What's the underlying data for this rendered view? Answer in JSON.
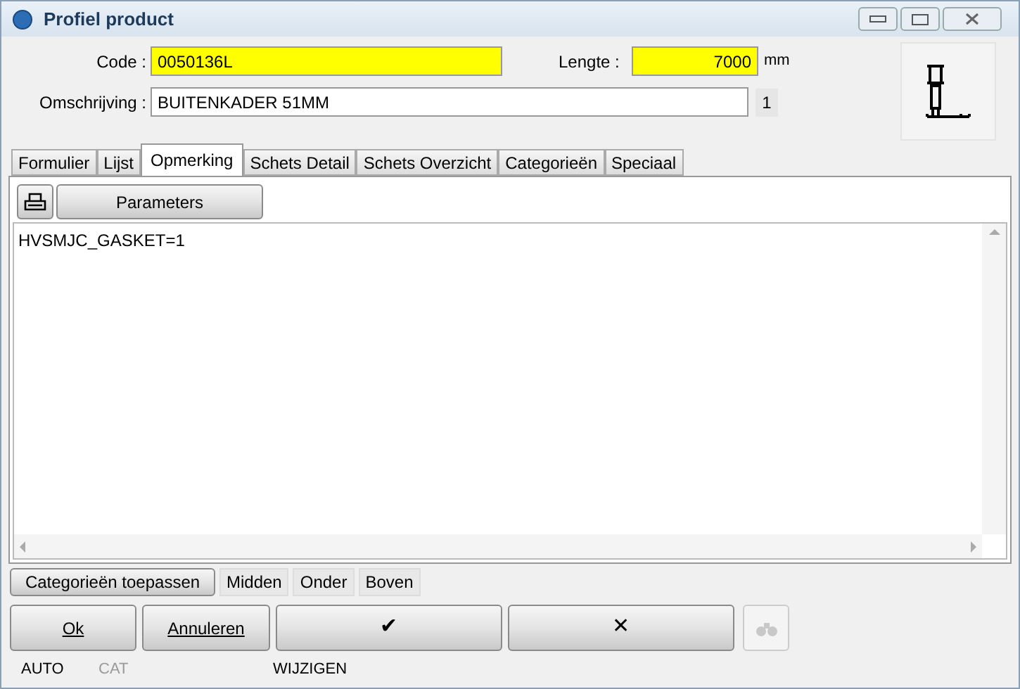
{
  "window": {
    "title": "Profiel product"
  },
  "fields": {
    "code_label": "Code :",
    "code": "0050136L",
    "length_label": "Lengte :",
    "length": "7000",
    "length_unit": "mm",
    "description_label": "Omschrijving :",
    "description": "BUITENKADER 51MM",
    "count": "1"
  },
  "tabs": [
    {
      "label": "Formulier",
      "selected": false
    },
    {
      "label": "Lijst",
      "selected": false
    },
    {
      "label": "Opmerking",
      "selected": true
    },
    {
      "label": "Schets Detail",
      "selected": false
    },
    {
      "label": "Schets Overzicht",
      "selected": false
    },
    {
      "label": "Categorieën",
      "selected": false
    },
    {
      "label": "Speciaal",
      "selected": false
    }
  ],
  "toolbar": {
    "parameters": "Parameters"
  },
  "remark": "HVSMJC_GASKET=1",
  "position_buttons": [
    "Categorieën toepassen",
    "Midden",
    "Onder",
    "Boven"
  ],
  "actions": [
    {
      "kind": "text",
      "label": "Ok",
      "disabled": false
    },
    {
      "kind": "text",
      "label": "Annuleren",
      "disabled": false
    },
    {
      "kind": "text",
      "label": "✔",
      "disabled": false
    },
    {
      "kind": "text",
      "label": "✕",
      "disabled": false
    },
    {
      "kind": "search",
      "disabled": true
    }
  ],
  "status_bar": [
    {
      "label": "AUTO",
      "disabled": false
    },
    {
      "label": "CAT",
      "disabled": true
    },
    {
      "label": "WIJZIGEN",
      "disabled": false
    }
  ]
}
